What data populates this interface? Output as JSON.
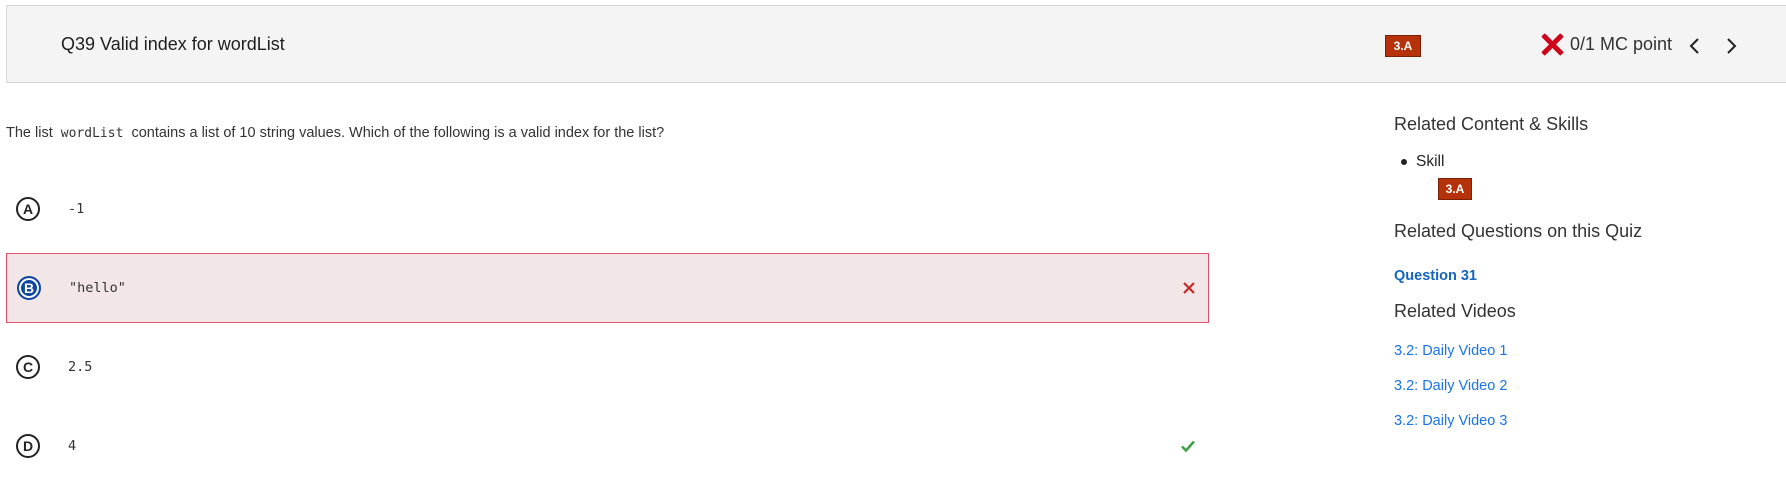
{
  "header": {
    "title": "Q39 Valid index for wordList",
    "skill_badge": "3.A",
    "score_text": "0/1 MC point"
  },
  "question": {
    "prefix": "The list",
    "code": "wordList",
    "suffix": "contains a list of 10 string values. Which of the following is a valid index for the list?"
  },
  "choices": [
    {
      "letter": "A",
      "value": "-1",
      "state": "none"
    },
    {
      "letter": "B",
      "value": "\"hello\"",
      "state": "selected-wrong"
    },
    {
      "letter": "C",
      "value": "2.5",
      "state": "none"
    },
    {
      "letter": "D",
      "value": "4",
      "state": "correct"
    }
  ],
  "sidebar": {
    "related_title": "Related Content & Skills",
    "skill_label": "Skill",
    "skill_badge": "3.A",
    "related_questions_title": "Related Questions on this Quiz",
    "related_question_link": "Question 31",
    "related_videos_title": "Related Videos",
    "videos": [
      "3.2: Daily Video 1",
      "3.2: Daily Video 2",
      "3.2: Daily Video 3"
    ]
  },
  "colors": {
    "badge": "#b5310a",
    "wrong": "#d0021b",
    "correct": "#43a047",
    "selected_bg": "#f3e6e7",
    "link": "#1a73e8"
  }
}
